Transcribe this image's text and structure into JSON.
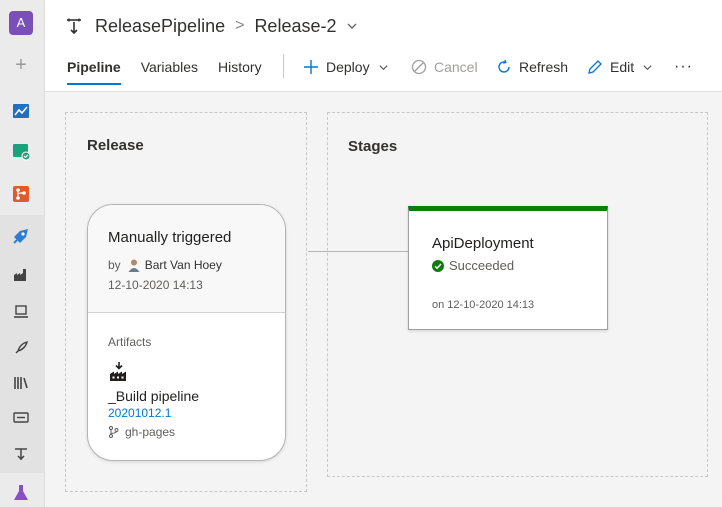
{
  "rail": {
    "org_initial": "A",
    "items": [
      "overview",
      "boards",
      "repos",
      "pipelines",
      "builds",
      "deployment-groups",
      "releases",
      "library",
      "task-groups",
      "release-pipelines",
      "test-plans"
    ]
  },
  "header": {
    "pipeline_name": "ReleasePipeline",
    "separator": ">",
    "release_name": "Release-2"
  },
  "tabs": [
    {
      "label": "Pipeline",
      "active": true
    },
    {
      "label": "Variables",
      "active": false
    },
    {
      "label": "History",
      "active": false
    }
  ],
  "toolbar": {
    "deploy": "Deploy",
    "cancel": "Cancel",
    "refresh": "Refresh",
    "edit": "Edit",
    "more": "···"
  },
  "release_panel": {
    "title": "Release",
    "card": {
      "trigger": "Manually triggered",
      "by_label": "by",
      "author": "Bart Van Hoey",
      "date": "12-10-2020 14:13",
      "artifacts_label": "Artifacts",
      "artifact_name": "_Build pipeline",
      "artifact_version": "20201012.1",
      "branch": "gh-pages"
    }
  },
  "stages_panel": {
    "title": "Stages",
    "stage": {
      "name": "ApiDeployment",
      "status": "Succeeded",
      "completed_on": "on 12-10-2020 14:13"
    }
  },
  "colors": {
    "accent": "#0078d4",
    "success": "#107c10",
    "org": "#7b4fb8"
  }
}
